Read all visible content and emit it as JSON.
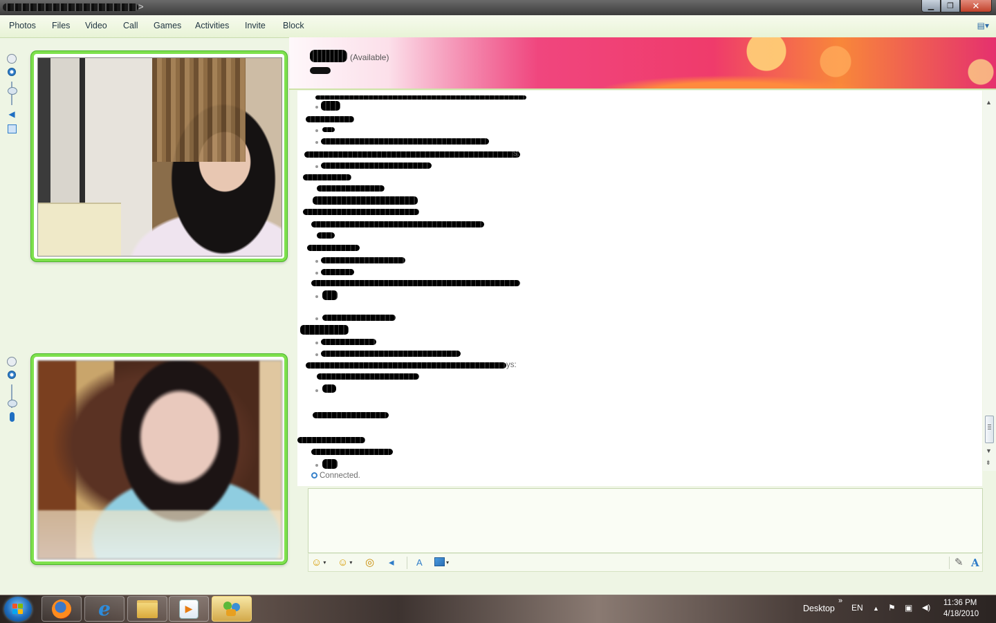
{
  "window": {
    "minimize_glyph": "▁",
    "maximize_glyph": "❐",
    "close_glyph": "✕",
    "title_arrow": ">"
  },
  "menu": {
    "items": [
      "Photos",
      "Files",
      "Video",
      "Call",
      "Games",
      "Activities",
      "Invite",
      "Block"
    ],
    "tools_glyph": "▤▾"
  },
  "contact": {
    "status": "(Available)"
  },
  "conversation": {
    "partial_line_1": "s:",
    "partial_line_2": "ys:",
    "connected_text": "Connected."
  },
  "scroll": {
    "up_glyph": "▲",
    "down_glyph": "▼",
    "end_glyph": "⇟"
  },
  "format_bar": {
    "emoticon_glyph": "☺",
    "wink_glyph": "☺",
    "nudge_glyph": "◎",
    "voice_clip_glyph": "◂",
    "font_glyph": "A",
    "handwriting_glyph": "✎",
    "text_glyph": "A",
    "caret": "▾"
  },
  "taskbar": {
    "desktop_label": "Desktop",
    "desktop_chevron": "»",
    "language": "EN",
    "time": "11:36 PM",
    "date": "4/18/2010",
    "tray_up_glyph": "▲",
    "flag_glyph": "⚑",
    "network_glyph": "▣",
    "volume_glyph": "◀)",
    "media_glyph": "▶",
    "ie_glyph": "e"
  },
  "colors": {
    "video_border": "#7ee04d",
    "banner_pink": "#e51e6b",
    "banner_orange": "#f8873a",
    "accent_blue": "#2f7cc8"
  }
}
